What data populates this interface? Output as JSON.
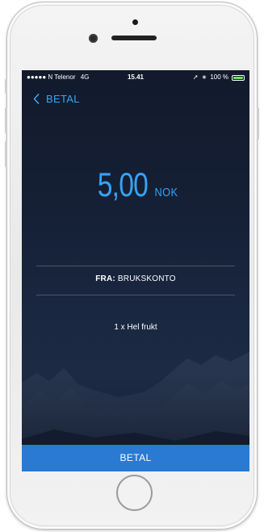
{
  "status_bar": {
    "carrier": "●●●●● N Telenor",
    "network": "4G",
    "time": "15.41",
    "location_icon": "➚",
    "bluetooth_icon": "∗",
    "battery_text": "100 %"
  },
  "nav": {
    "back_label": "BETAL"
  },
  "payment": {
    "amount": "5,00",
    "currency": "NOK",
    "from_label": "FRA:",
    "from_account": "BRUKSKONTO",
    "item": "1 x Hel frukt"
  },
  "pay_button": {
    "label": "BETAL"
  },
  "colors": {
    "accent": "#36a3f3",
    "button": "#2a79d2",
    "background": "#152036"
  }
}
